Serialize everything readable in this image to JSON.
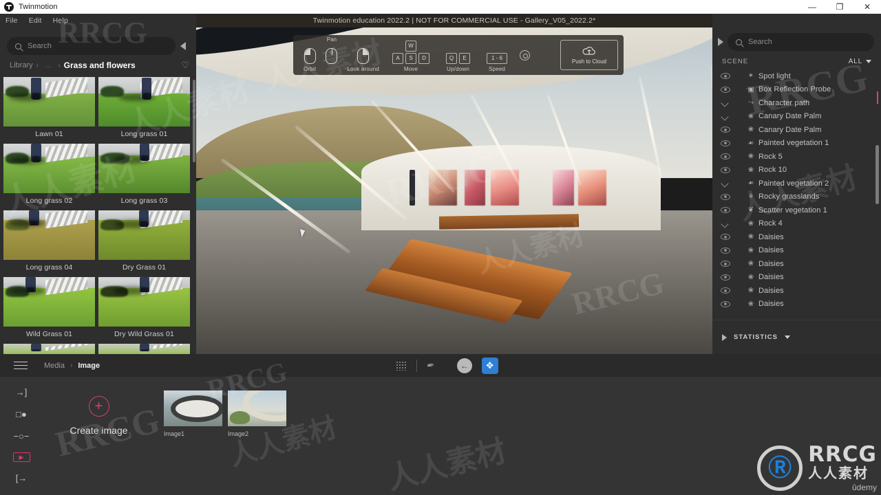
{
  "window": {
    "app_name": "Twinmotion",
    "minimize": "—",
    "maximize": "❐",
    "close": "✕"
  },
  "menubar": {
    "items": [
      "File",
      "Edit",
      "Help"
    ]
  },
  "document_title": "Twinmotion education 2022.2 | NOT FOR COMMERCIAL USE - Gallery_V05_2022.2*",
  "library": {
    "search_placeholder": "Search",
    "breadcrumb": {
      "root": "Library",
      "sep1": "›",
      "mid": "...",
      "sep2": "›",
      "current": "Grass and flowers"
    },
    "favorite_icon": "♡",
    "items": [
      {
        "label": "Lawn 01",
        "variant": "a"
      },
      {
        "label": "Long grass 01",
        "variant": "b"
      },
      {
        "label": "Long grass 02",
        "variant": "c"
      },
      {
        "label": "Long grass 03",
        "variant": "d"
      },
      {
        "label": "Long grass 04",
        "variant": "e"
      },
      {
        "label": "Dry Grass 01",
        "variant": "f"
      },
      {
        "label": "Wild Grass 01",
        "variant": "g"
      },
      {
        "label": "Dry Wild Grass 01",
        "variant": "h"
      },
      {
        "label": "",
        "variant": "i"
      },
      {
        "label": "",
        "variant": "j"
      }
    ]
  },
  "viewport": {
    "navbar": {
      "orbit": {
        "label": "Orbit"
      },
      "pan": {
        "label": "Pan",
        "middle_glyph": "○"
      },
      "look_around": {
        "label": "Look around"
      },
      "move": {
        "label": "Move",
        "keys": [
          "W",
          "A",
          "S",
          "D"
        ],
        "subs": [
          "↑ ↑",
          "← ←",
          "↓ ↓",
          "→ →"
        ]
      },
      "updown": {
        "label": "Up/down",
        "keys": [
          "Q",
          "E"
        ],
        "subs": [
          "↓ ↓",
          "↑ ↑"
        ]
      },
      "speed": {
        "label": "Speed",
        "range": "1 - 6"
      },
      "settings_icon": "gear",
      "push_to_cloud": {
        "label": "Push to Cloud"
      }
    },
    "icons": {
      "panel": "layout-panel",
      "eye": "eye"
    }
  },
  "scene_panel": {
    "search_placeholder": "Search",
    "header": {
      "title": "SCENE",
      "filter": "ALL"
    },
    "items": [
      {
        "name": "Spot light",
        "toggle": "eye",
        "icon": "✶"
      },
      {
        "name": "Box Reflection Probe",
        "toggle": "eye",
        "icon": "▣"
      },
      {
        "name": "Character path",
        "toggle": "chev",
        "icon": "⤳"
      },
      {
        "name": "Canary Date Palm",
        "toggle": "chev",
        "icon": "❀"
      },
      {
        "name": "Canary Date Palm",
        "toggle": "eye",
        "icon": "❀"
      },
      {
        "name": "Painted vegetation 1",
        "toggle": "eye",
        "icon": "☙"
      },
      {
        "name": "Rock 5",
        "toggle": "eye",
        "icon": "❀"
      },
      {
        "name": "Rock 10",
        "toggle": "eye",
        "icon": "❀"
      },
      {
        "name": "Painted vegetation 2",
        "toggle": "chev",
        "icon": "☙"
      },
      {
        "name": "Rocky grasslands",
        "toggle": "eye",
        "icon": "⚘"
      },
      {
        "name": "Scatter vegetation 1",
        "toggle": "eye",
        "icon": "❦"
      },
      {
        "name": "Rock 4",
        "toggle": "chev",
        "icon": "❀"
      },
      {
        "name": "Daisies",
        "toggle": "eye",
        "icon": "❀"
      },
      {
        "name": "Daisies",
        "toggle": "eye",
        "icon": "❀"
      },
      {
        "name": "Daisies",
        "toggle": "eye",
        "icon": "❀"
      },
      {
        "name": "Daisies",
        "toggle": "eye",
        "icon": "❀"
      },
      {
        "name": "Daisies",
        "toggle": "eye",
        "icon": "❀"
      },
      {
        "name": "Daisies",
        "toggle": "eye",
        "icon": "❀"
      }
    ],
    "statistics": {
      "label": "STATISTICS"
    }
  },
  "media_bar": {
    "breadcrumb": {
      "root": "Media",
      "sep": "›",
      "current": "Image"
    },
    "grid_icon": "grid",
    "pipette_icon": "✒",
    "back_button": "←",
    "move_tool": "✥"
  },
  "bottom": {
    "rail_icons": [
      "import",
      "profile",
      "path",
      "media",
      "export"
    ],
    "media_tab_glyph": "▶",
    "create": {
      "plus": "+",
      "label": "Create image"
    },
    "images": [
      {
        "label": "Image1",
        "variant": "a"
      },
      {
        "label": "Image2",
        "variant": "b"
      }
    ]
  },
  "watermark": {
    "brand": "RRCG",
    "cn": "人人素材",
    "udemy": "ûdemy",
    "logo_letter": "Ⓡ"
  },
  "colors": {
    "panel_bg": "#2e2e2e",
    "bottom_bg": "#343434",
    "accent_pink": "#e4326d",
    "accent_blue": "#2f7fd4",
    "text_primary": "#e0e0e0",
    "text_muted": "#8e8e8e"
  }
}
